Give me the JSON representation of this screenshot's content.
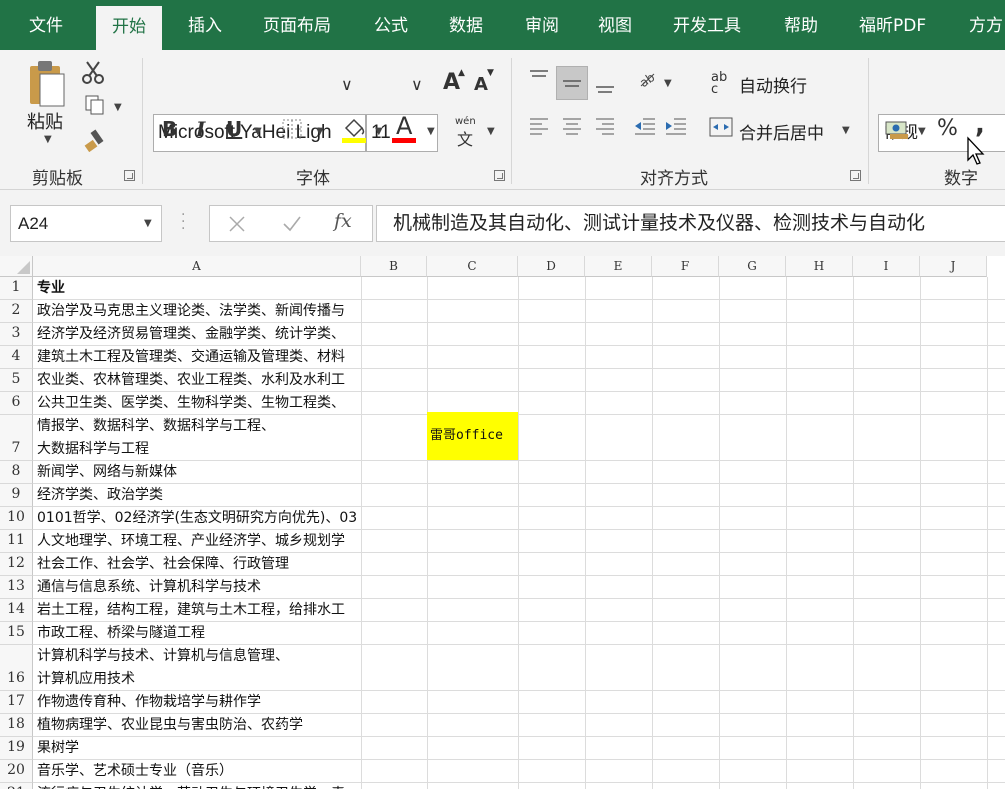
{
  "tabs": [
    "文件",
    "开始",
    "插入",
    "页面布局",
    "公式",
    "数据",
    "审阅",
    "视图",
    "开发工具",
    "帮助",
    "福昕PDF",
    "方方"
  ],
  "active_tab_index": 1,
  "clipboard": {
    "paste_label": "粘贴",
    "group_label": "剪贴板"
  },
  "font": {
    "name": "Microsoft YaHei Ligh",
    "size": "11",
    "group_label": "字体",
    "bold": "B",
    "italic": "I",
    "underline": "U",
    "grow": "A",
    "shrink": "A",
    "font_color_glyph": "A",
    "phonetic_top": "wén",
    "phonetic_bottom": "文",
    "fill_color": "#ffff00",
    "font_color": "#ff0000"
  },
  "alignment": {
    "wrap_text_label": "自动换行",
    "wrap_glyph_top": "ab",
    "wrap_glyph_bottom": "c",
    "merge_center_label": "合并后居中",
    "group_label": "对齐方式"
  },
  "number": {
    "format": "常规",
    "group_label": "数字",
    "percent": "%",
    "comma": ","
  },
  "formula_bar": {
    "name_box": "A24",
    "fx": "fx",
    "formula": "机械制造及其自动化、测试计量技术及仪器、检测技术与自动化"
  },
  "columns": [
    "A",
    "B",
    "C",
    "D",
    "E",
    "F",
    "G",
    "H",
    "I",
    "J"
  ],
  "rows": [
    {
      "num": "1",
      "lines": [
        "专业"
      ]
    },
    {
      "num": "2",
      "lines": [
        "政治学及马克思主义理论类、法学类、新闻传播与"
      ]
    },
    {
      "num": "3",
      "lines": [
        "经济学及经济贸易管理类、金融学类、统计学类、"
      ]
    },
    {
      "num": "4",
      "lines": [
        "建筑土木工程及管理类、交通运输及管理类、材料"
      ]
    },
    {
      "num": "5",
      "lines": [
        "农业类、农林管理类、农业工程类、水利及水利工"
      ]
    },
    {
      "num": "6",
      "lines": [
        "公共卫生类、医学类、生物科学类、生物工程类、"
      ]
    },
    {
      "num": "7",
      "lines": [
        "情报学、数据科学、数据科学与工程、",
        "大数据科学与工程"
      ]
    },
    {
      "num": "8",
      "lines": [
        "新闻学、网络与新媒体"
      ]
    },
    {
      "num": "9",
      "lines": [
        "经济学类、政治学类"
      ]
    },
    {
      "num": "10",
      "lines": [
        "0101哲学、02经济学(生态文明研究方向优先)、03"
      ]
    },
    {
      "num": "11",
      "lines": [
        "人文地理学、环境工程、产业经济学、城乡规划学"
      ]
    },
    {
      "num": "12",
      "lines": [
        "社会工作、社会学、社会保障、行政管理"
      ]
    },
    {
      "num": "13",
      "lines": [
        "通信与信息系统、计算机科学与技术"
      ]
    },
    {
      "num": "14",
      "lines": [
        "岩土工程，结构工程，建筑与土木工程，给排水工"
      ]
    },
    {
      "num": "15",
      "lines": [
        "市政工程、桥梁与隧道工程"
      ]
    },
    {
      "num": "16",
      "lines": [
        "计算机科学与技术、计算机与信息管理、",
        "计算机应用技术"
      ]
    },
    {
      "num": "17",
      "lines": [
        "作物遗传育种、作物栽培学与耕作学"
      ]
    },
    {
      "num": "18",
      "lines": [
        "植物病理学、农业昆虫与害虫防治、农药学"
      ]
    },
    {
      "num": "19",
      "lines": [
        "果树学"
      ]
    },
    {
      "num": "20",
      "lines": [
        "音乐学、艺术硕士专业（音乐）"
      ]
    },
    {
      "num": "21",
      "lines": [
        "流行病与卫生统计学、劳动卫生与环境卫生学、毒"
      ]
    }
  ],
  "highlight_cell": {
    "ref": "C7",
    "text": "雷哥office",
    "color": "#ffff00"
  },
  "colors": {
    "ribbon_green": "#217346"
  }
}
